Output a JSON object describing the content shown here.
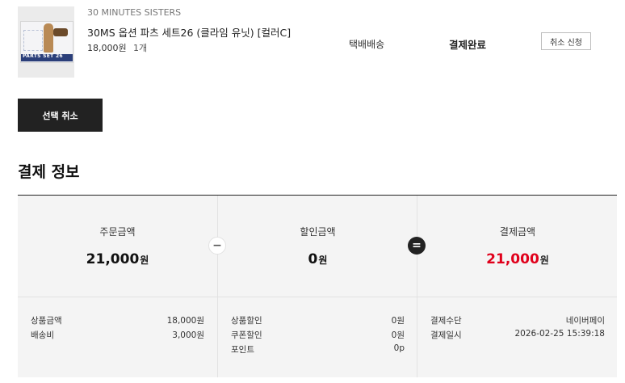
{
  "product": {
    "brand": "30 MINUTES SISTERS",
    "name": "30MS 옵션 파츠 세트26 (클라임 유닛) [컬러C]",
    "price": "18,000원",
    "quantity": "1개",
    "thumbnail_text": "PARTS SET 26",
    "shipping": "택배배송",
    "status": "결제완료",
    "cancel_request_label": "취소 신청"
  },
  "actions": {
    "select_cancel_label": "선택 취소"
  },
  "payment": {
    "title": "결제 정보",
    "summary": {
      "order": {
        "label": "주문금액",
        "amount": "21,000",
        "unit": "원"
      },
      "discount": {
        "label": "할인금액",
        "amount": "0",
        "unit": "원"
      },
      "total": {
        "label": "결제금액",
        "amount": "21,000",
        "unit": "원"
      },
      "minus_symbol": "−",
      "equals_symbol": "="
    },
    "order_details": [
      {
        "label": "상품금액",
        "value": "18,000원"
      },
      {
        "label": "배송비",
        "value": "3,000원"
      }
    ],
    "discount_details": [
      {
        "label": "상품할인",
        "value": "0원"
      },
      {
        "label": "쿠폰할인",
        "value": "0원"
      },
      {
        "label": "포인트",
        "value": "0p"
      }
    ],
    "payment_details": [
      {
        "label": "결제수단",
        "value": "네이버페이"
      },
      {
        "label": "결제일시",
        "value": "2026-02-25 15:39:18"
      }
    ]
  },
  "colors": {
    "total_amount": "#e0001b",
    "button_dark": "#222222",
    "panel_bg": "#f4f4f4"
  }
}
